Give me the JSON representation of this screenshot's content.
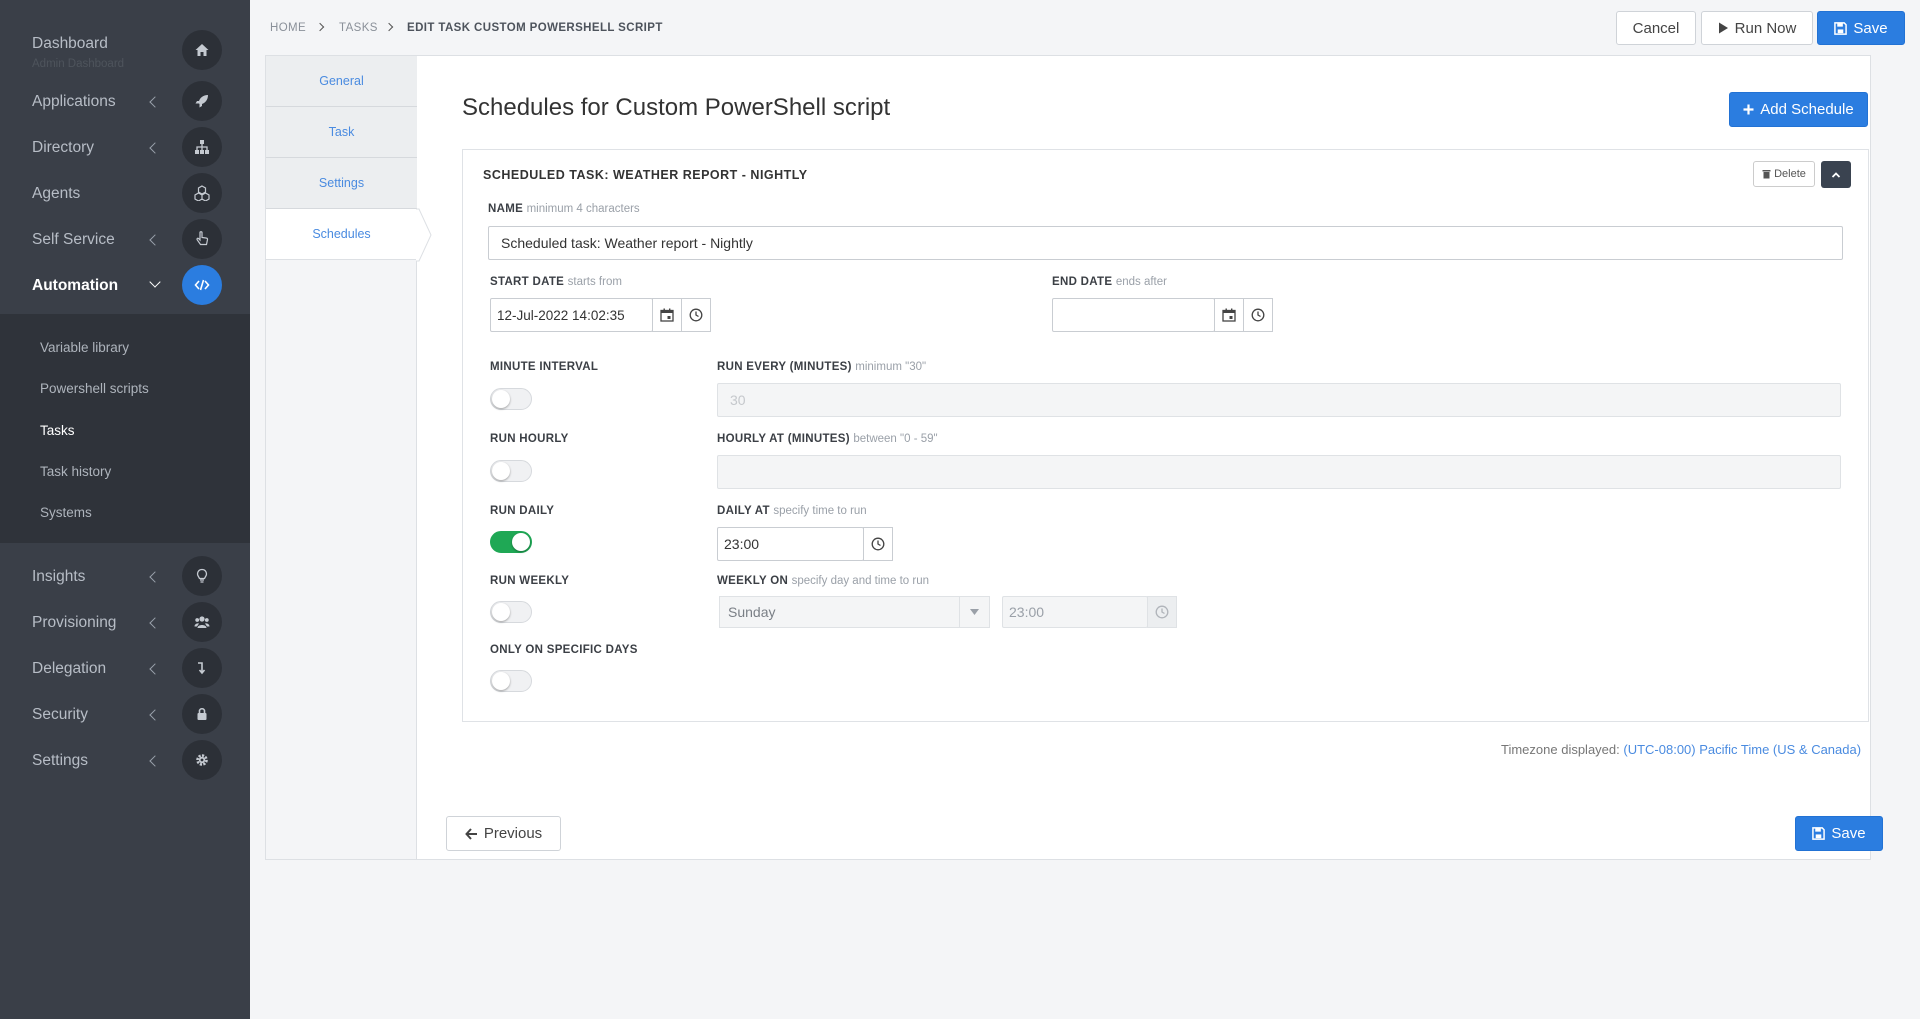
{
  "sidebar": {
    "items": [
      {
        "label": "Dashboard",
        "icon": "home-icon"
      },
      {
        "label": "Applications",
        "icon": "rocket-icon"
      },
      {
        "label": "Directory",
        "icon": "sitemap-icon"
      },
      {
        "label": "Agents",
        "icon": "cubes-icon"
      },
      {
        "label": "Self Service",
        "icon": "hand-pointer-icon"
      },
      {
        "label": "Automation",
        "icon": "code-icon"
      },
      {
        "label": "Insights",
        "icon": "lightbulb-icon"
      },
      {
        "label": "Provisioning",
        "icon": "users-icon"
      },
      {
        "label": "Delegation",
        "icon": "level-down-icon"
      },
      {
        "label": "Security",
        "icon": "lock-icon"
      },
      {
        "label": "Settings",
        "icon": "cog-icon"
      }
    ],
    "dashboard_sublabel": "Admin Dashboard",
    "submenu": [
      "Variable library",
      "Powershell scripts",
      "Tasks",
      "Task history",
      "Systems"
    ],
    "active_item": "Automation",
    "active_subitem": "Tasks",
    "accent_color": "#2b7de0"
  },
  "breadcrumb": [
    "HOME",
    "TASKS",
    "EDIT TASK CUSTOM POWERSHELL SCRIPT"
  ],
  "toolbar": {
    "cancel": "Cancel",
    "run_now": "Run Now",
    "save": "Save"
  },
  "tabs": [
    "General",
    "Task",
    "Settings",
    "Schedules"
  ],
  "active_tab": "Schedules",
  "page_title": "Schedules for Custom PowerShell script",
  "add_schedule": "Add Schedule",
  "schedule": {
    "title": "SCHEDULED TASK: WEATHER REPORT - NIGHTLY",
    "delete_label": "Delete",
    "name_label": "NAME",
    "name_hint": "minimum 4 characters",
    "name_value": "Scheduled task: Weather report - Nightly",
    "start_label": "START DATE",
    "start_hint": "starts from",
    "start_value": "12-Jul-2022 14:02:35",
    "end_label": "END DATE",
    "end_hint": "ends after",
    "end_value": "",
    "minute_interval_label": "MINUTE INTERVAL",
    "minute_interval_on": false,
    "run_every_label": "RUN EVERY (MINUTES)",
    "run_every_hint": "minimum \"30\"",
    "run_every_placeholder": "30",
    "run_hourly_label": "RUN HOURLY",
    "run_hourly_on": false,
    "hourly_at_label": "HOURLY AT (MINUTES)",
    "hourly_at_hint": "between \"0 - 59\"",
    "hourly_at_value": "",
    "run_daily_label": "RUN DAILY",
    "run_daily_on": true,
    "daily_at_label": "DAILY AT",
    "daily_at_hint": "specify time to run",
    "daily_at_value": "23:00",
    "run_weekly_label": "RUN WEEKLY",
    "run_weekly_on": false,
    "weekly_on_label": "WEEKLY ON",
    "weekly_on_hint": "specify day and time to run",
    "weekly_day": "Sunday",
    "weekly_time": "23:00",
    "specific_days_label": "ONLY ON SPECIFIC DAYS",
    "specific_days_on": false
  },
  "timezone": {
    "prefix": "Timezone displayed:",
    "value": "(UTC-08:00) Pacific Time (US & Canada)"
  },
  "footer": {
    "previous": "Previous",
    "save": "Save"
  }
}
